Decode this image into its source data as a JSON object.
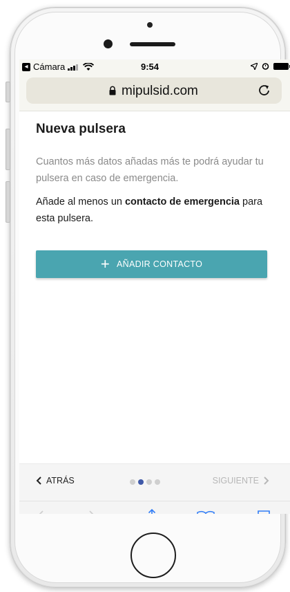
{
  "status_bar": {
    "back_app": "Cámara",
    "time": "9:54"
  },
  "address_bar": {
    "url": "mipulsid.com"
  },
  "page": {
    "title": "Nueva pulsera",
    "intro": "Cuantos más datos añadas más te podrá ayudar tu pulsera en caso de emergencia.",
    "instruction_prefix": "Añade al menos un ",
    "instruction_bold": "contacto de emergencia",
    "instruction_suffix": " para esta pulsera.",
    "add_button": "AÑADIR CONTACTO"
  },
  "pager": {
    "back_label": "ATRÁS",
    "next_label": "SIGUIENTE",
    "total_steps": 4,
    "current_step": 2
  },
  "colors": {
    "accent": "#4aa5b0",
    "active_dot": "#3f59a8",
    "ios_blue": "#2f7cf6"
  },
  "icons": {
    "lock": "lock-icon",
    "reload": "reload-icon",
    "share": "share-icon",
    "bookmarks": "bookmarks-icon",
    "tabs": "tabs-icon"
  }
}
